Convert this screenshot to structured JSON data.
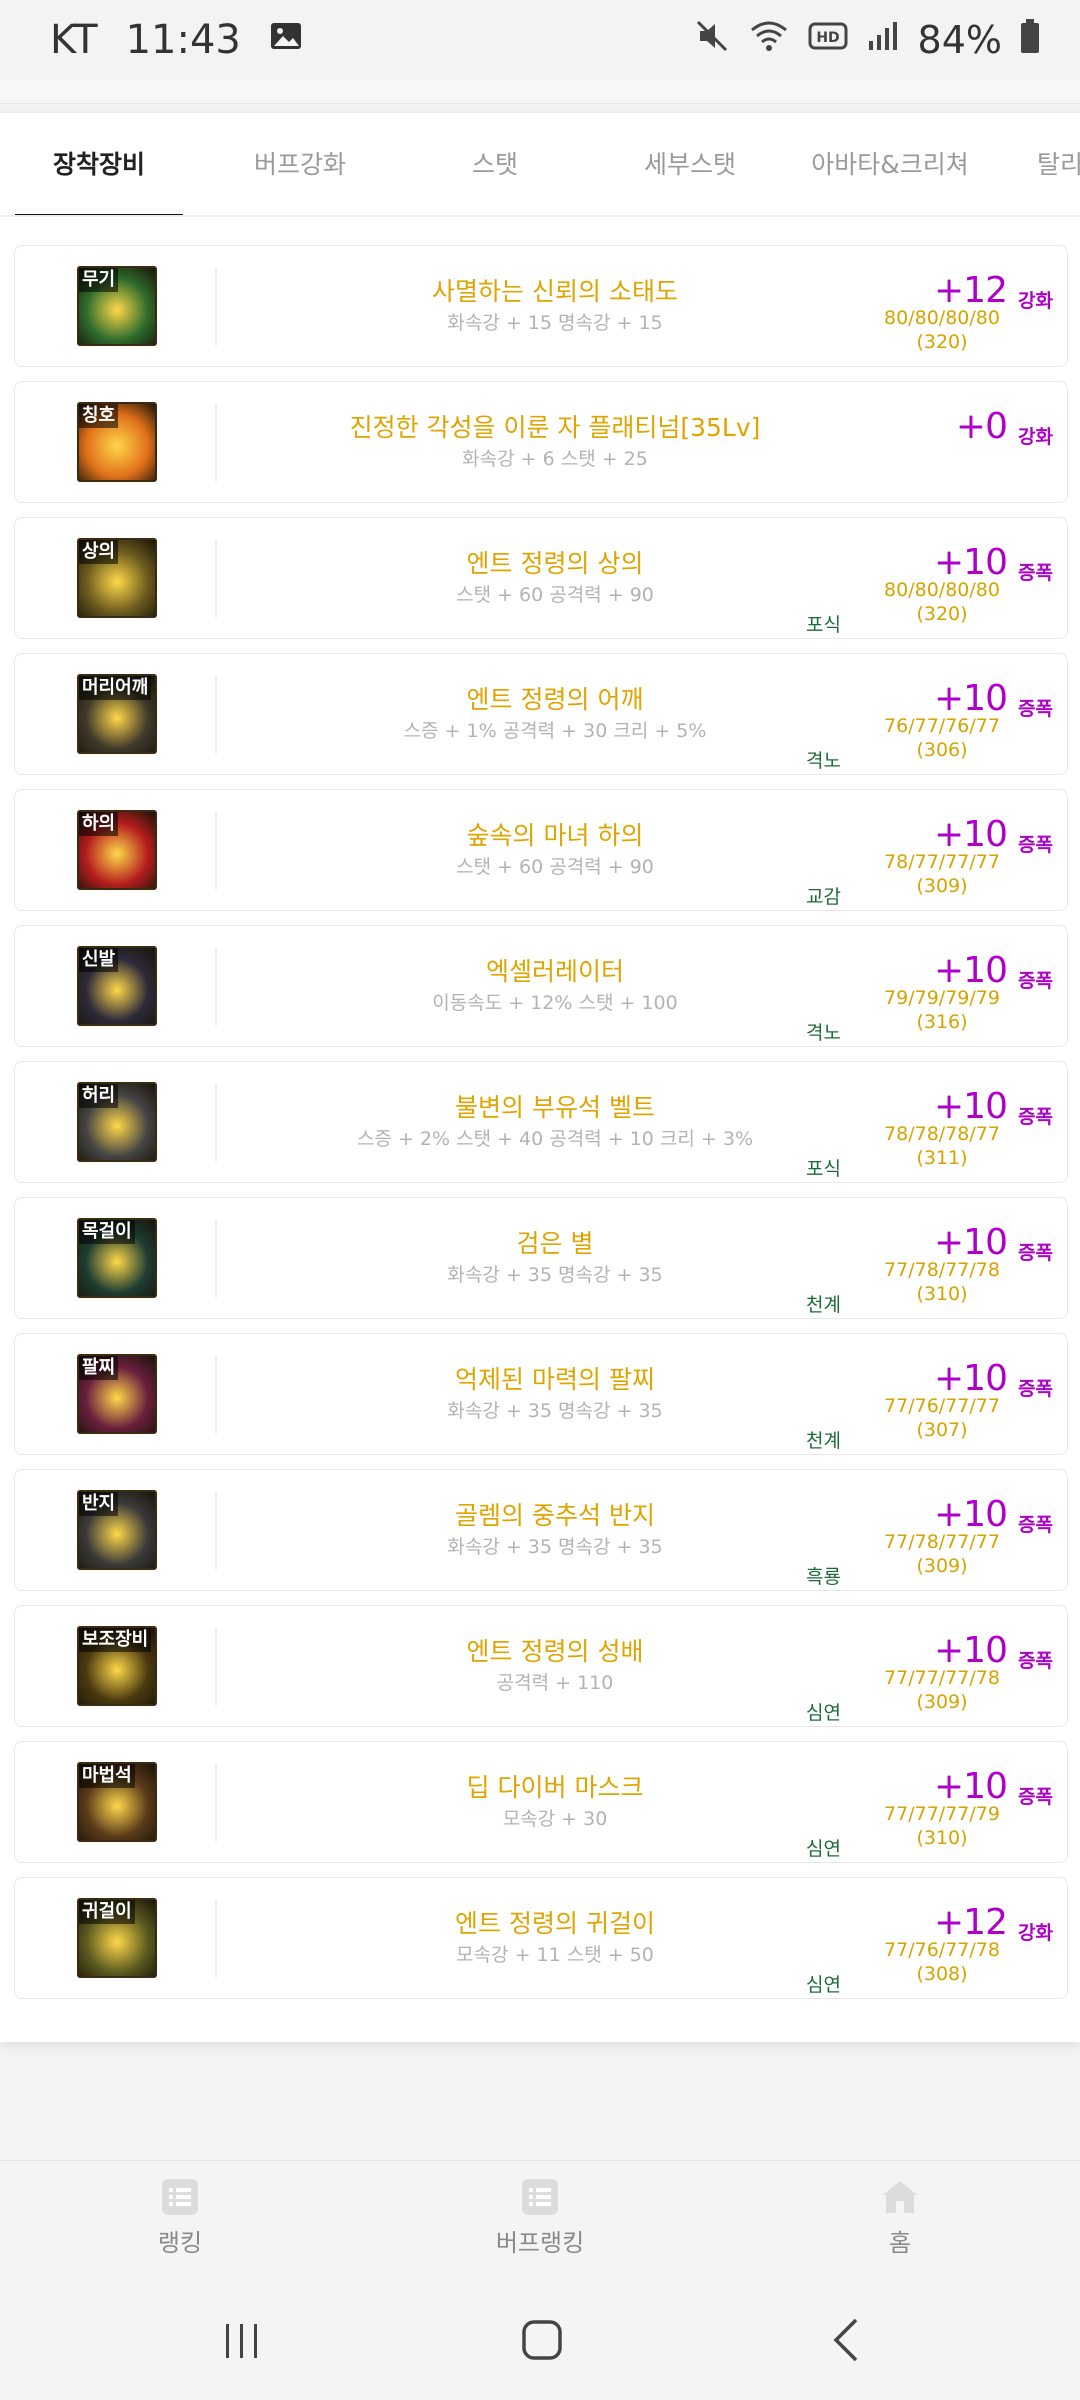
{
  "status": {
    "carrier": "KT",
    "time": "11:43",
    "battery": "84%"
  },
  "tabs": [
    "장착장비",
    "버프강화",
    "스탯",
    "세부스탯",
    "아바타&크리쳐",
    "탈리"
  ],
  "active_tab": 0,
  "items": [
    {
      "slot": "무기",
      "name": "사멸하는 신뢰의 소태도",
      "stats": "화속강 + 15 명속강 + 15",
      "tag": "",
      "enh": "+12",
      "enh_type": "강화",
      "nums": "80/80/80/80",
      "total": "(320)",
      "color": "#2e6b2c"
    },
    {
      "slot": "칭호",
      "name": "진정한 각성을 이룬 자 플래티넘[35Lv]",
      "stats": "화속강 + 6 스탯 + 25",
      "tag": "",
      "enh": "+0",
      "enh_type": "강화",
      "nums": "",
      "total": "",
      "color": "#e0701a"
    },
    {
      "slot": "상의",
      "name": "엔트 정령의 상의",
      "stats": "스탯 + 60 공격력 + 90",
      "tag": "포식",
      "enh": "+10",
      "enh_type": "증폭",
      "nums": "80/80/80/80",
      "total": "(320)",
      "color": "#6b5a1e"
    },
    {
      "slot": "머리어깨",
      "name": "엔트 정령의 어깨",
      "stats": "스증 + 1% 공격력 + 30 크리 + 5%",
      "tag": "격노",
      "enh": "+10",
      "enh_type": "증폭",
      "nums": "76/77/76/77",
      "total": "(306)",
      "color": "#3f3a2a"
    },
    {
      "slot": "하의",
      "name": "숲속의 마녀 하의",
      "stats": "스탯 + 60 공격력 + 90",
      "tag": "교감",
      "enh": "+10",
      "enh_type": "증폭",
      "nums": "78/77/77/77",
      "total": "(309)",
      "color": "#b41d1d"
    },
    {
      "slot": "신발",
      "name": "엑셀러레이터",
      "stats": "이동속도 + 12% 스탯 + 100",
      "tag": "격노",
      "enh": "+10",
      "enh_type": "증폭",
      "nums": "79/79/79/79",
      "total": "(316)",
      "color": "#2d2a3a"
    },
    {
      "slot": "허리",
      "name": "불변의 부유석 벨트",
      "stats": "스증 + 2% 스탯 + 40 공격력 + 10 크리 + 3%",
      "tag": "포식",
      "enh": "+10",
      "enh_type": "증폭",
      "nums": "78/78/78/77",
      "total": "(311)",
      "color": "#444444"
    },
    {
      "slot": "목걸이",
      "name": "검은 별",
      "stats": "화속강 + 35 명속강 + 35",
      "tag": "천계",
      "enh": "+10",
      "enh_type": "증폭",
      "nums": "77/78/77/78",
      "total": "(310)",
      "color": "#1e3d33"
    },
    {
      "slot": "팔찌",
      "name": "억제된 마력의 팔찌",
      "stats": "화속강 + 35 명속강 + 35",
      "tag": "천계",
      "enh": "+10",
      "enh_type": "증폭",
      "nums": "77/76/77/77",
      "total": "(307)",
      "color": "#6a1f3d"
    },
    {
      "slot": "반지",
      "name": "골렘의 중추석 반지",
      "stats": "화속강 + 35 명속강 + 35",
      "tag": "흑룡",
      "enh": "+10",
      "enh_type": "증폭",
      "nums": "77/78/77/77",
      "total": "(309)",
      "color": "#3a3a3a"
    },
    {
      "slot": "보조장비",
      "name": "엔트 정령의 성배",
      "stats": "공격력 + 110",
      "tag": "심연",
      "enh": "+10",
      "enh_type": "증폭",
      "nums": "77/77/77/78",
      "total": "(309)",
      "color": "#4b3a10"
    },
    {
      "slot": "마법석",
      "name": "딥 다이버 마스크",
      "stats": "모속강 + 30",
      "tag": "심연",
      "enh": "+10",
      "enh_type": "증폭",
      "nums": "77/77/77/79",
      "total": "(310)",
      "color": "#5a3a1a"
    },
    {
      "slot": "귀걸이",
      "name": "엔트 정령의 귀걸이",
      "stats": "모속강 + 11 스탯 + 50",
      "tag": "심연",
      "enh": "+12",
      "enh_type": "강화",
      "nums": "77/76/77/78",
      "total": "(308)",
      "color": "#5b5a20"
    }
  ],
  "bottom_nav": [
    {
      "label": "랭킹",
      "icon": "list-icon"
    },
    {
      "label": "버프랭킹",
      "icon": "list-icon"
    },
    {
      "label": "홈",
      "icon": "home-icon"
    }
  ]
}
